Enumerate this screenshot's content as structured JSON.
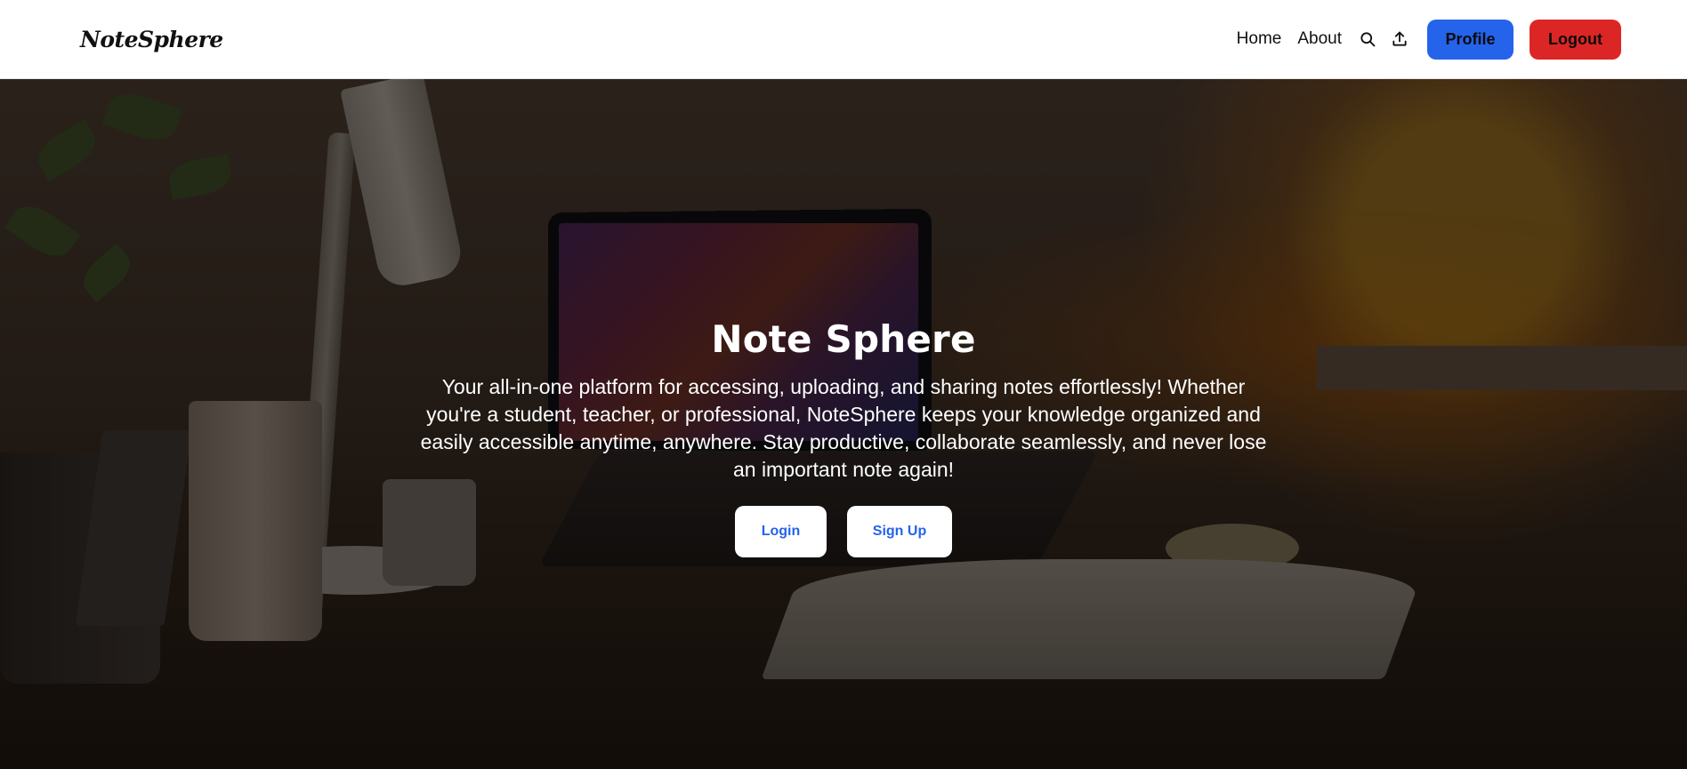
{
  "nav": {
    "brand": "NoteSphere",
    "links": {
      "home": "Home",
      "about": "About"
    },
    "icons": {
      "search": "search-icon",
      "upload": "upload-icon"
    },
    "profile_label": "Profile",
    "logout_label": "Logout"
  },
  "hero": {
    "title": "Note Sphere",
    "description": "Your all-in-one platform for accessing, uploading, and sharing notes effortlessly! Whether you're a student, teacher, or professional, NoteSphere keeps your knowledge organized and easily accessible anytime, anywhere. Stay productive, collaborate seamlessly, and never lose an important note again!",
    "login_label": "Login",
    "signup_label": "Sign Up"
  },
  "colors": {
    "profile_button": "#2563eb",
    "logout_button": "#dc2626",
    "hero_button_text": "#2563eb"
  }
}
